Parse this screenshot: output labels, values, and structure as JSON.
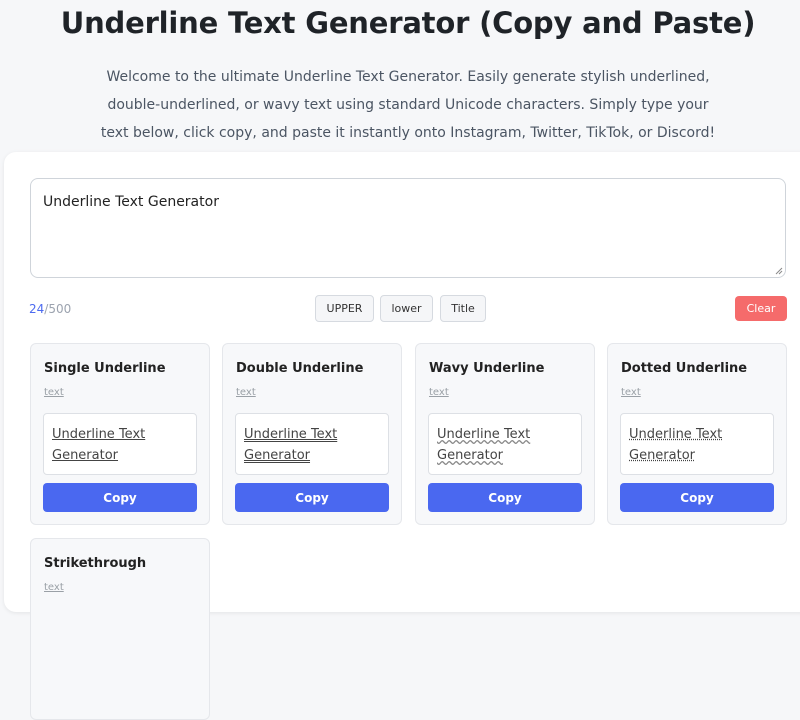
{
  "page": {
    "title": "Underline Text Generator (Copy and Paste)",
    "intro": "Welcome to the ultimate Underline Text Generator. Easily generate stylish underlined, double-underlined, or wavy text using standard Unicode characters. Simply type your text below, click copy, and paste it instantly onto Instagram, Twitter, TikTok, or Discord!"
  },
  "input": {
    "value": "Underline Text Generator",
    "count": "24",
    "max": "/500"
  },
  "case_buttons": {
    "upper": "UPPER",
    "lower": "lower",
    "title": "Title"
  },
  "clear_label": "Clear",
  "cards": [
    {
      "title": "Single Underline",
      "sub": "text",
      "output": "Underline Text Generator",
      "copy": "Copy"
    },
    {
      "title": "Double Underline",
      "sub": "text",
      "output": "Underline Text Generator",
      "copy": "Copy"
    },
    {
      "title": "Wavy Underline",
      "sub": "text",
      "output": "Underline Text Generator",
      "copy": "Copy"
    },
    {
      "title": "Dotted Underline",
      "sub": "text",
      "output": "Underline Text Generator",
      "copy": "Copy"
    },
    {
      "title": "Strikethrough",
      "sub": "text"
    }
  ],
  "colors": {
    "accent": "#4a68f0",
    "clear": "#f56b6b"
  }
}
